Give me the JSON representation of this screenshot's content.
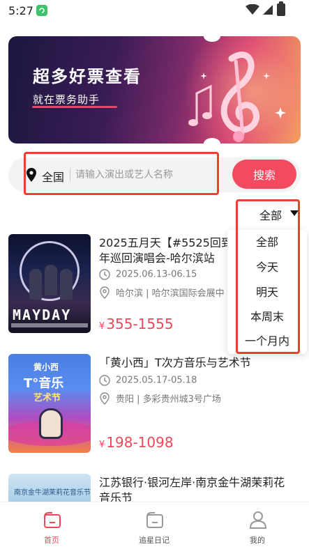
{
  "status_bar": {
    "time": "5:27"
  },
  "banner": {
    "title": "超多好票查看",
    "subtitle": "就在票务助手"
  },
  "search": {
    "region": "全国",
    "placeholder": "请输入演出或艺人名称",
    "button_label": "搜索"
  },
  "filter": {
    "selected": "全部",
    "options": [
      "全部",
      "今天",
      "明天",
      "本周末",
      "一个月内"
    ]
  },
  "events": [
    {
      "title": "2025五月天【#5525回到那一天】25周年巡回演唱会-哈尔滨站",
      "title_line1": "2025五月天【#5525回到",
      "title_line2": "年巡回演唱会-哈尔滨站",
      "date": "2025.06.13-06.15",
      "venue": "哈尔滨 | 哈尔滨国际会展中",
      "price": "355-1555",
      "currency": "¥",
      "poster_text": "MAYDAY"
    },
    {
      "title": "「黄小西」T次方音乐与艺术节",
      "date": "2025.05.17-05.18",
      "venue": "贵阳 | 多彩贵州城3号广场",
      "price": "198-1098",
      "currency": "¥",
      "poster_text": {
        "t1": "黄小西",
        "t2": "T°音乐",
        "t3": "艺术节"
      }
    },
    {
      "title_line1": "江苏银行·银河左岸·南京金牛湖茉莉花",
      "title_line2": "音乐节",
      "poster_text": "南京金牛湖茉莉花音乐节"
    }
  ],
  "bottom_nav": [
    {
      "label": "首页",
      "icon": "home-icon",
      "active": true
    },
    {
      "label": "追星日记",
      "icon": "folder-icon",
      "active": false
    },
    {
      "label": "我的",
      "icon": "user-icon",
      "active": false
    }
  ],
  "colors": {
    "accent": "#f24a5f",
    "highlight_box": "#e8422f"
  }
}
